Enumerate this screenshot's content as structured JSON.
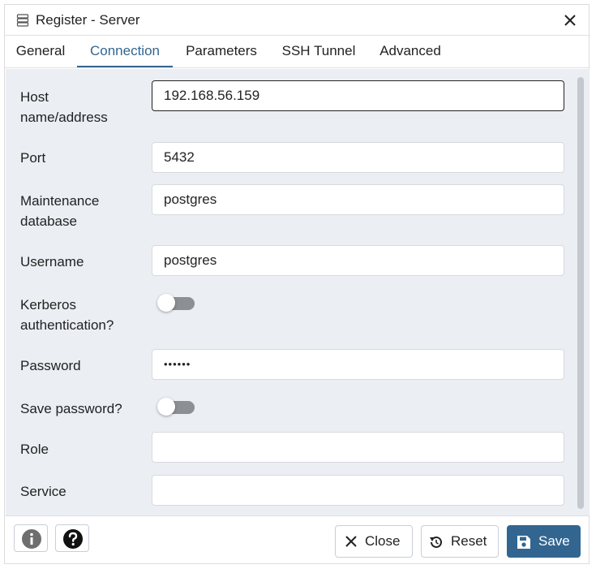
{
  "dialog": {
    "title": "Register - Server",
    "close_icon": "close-icon",
    "title_icon": "server-icon"
  },
  "tabs": [
    {
      "label": "General",
      "active": false
    },
    {
      "label": "Connection",
      "active": true
    },
    {
      "label": "Parameters",
      "active": false
    },
    {
      "label": "SSH Tunnel",
      "active": false
    },
    {
      "label": "Advanced",
      "active": false
    }
  ],
  "form": {
    "host": {
      "label_line1": "Host",
      "label_line2": "name/address",
      "value": "192.168.56.159"
    },
    "port": {
      "label": "Port",
      "value": "5432"
    },
    "maintenance_db": {
      "label_line1": "Maintenance",
      "label_line2": "database",
      "value": "postgres"
    },
    "username": {
      "label": "Username",
      "value": "postgres"
    },
    "kerberos": {
      "label_line1": "Kerberos",
      "label_line2": "authentication?",
      "enabled": false
    },
    "password": {
      "label": "Password",
      "value": "••••••"
    },
    "save_password": {
      "label": "Save password?",
      "enabled": false
    },
    "role": {
      "label": "Role",
      "value": ""
    },
    "service": {
      "label": "Service",
      "value": ""
    }
  },
  "footer": {
    "info_icon": "info-icon",
    "help_icon": "help-icon",
    "close_label": "Close",
    "reset_label": "Reset",
    "save_label": "Save"
  },
  "colors": {
    "accent": "#326690",
    "content_bg": "#ebeef3",
    "toggle_off": "#8c8f94"
  }
}
